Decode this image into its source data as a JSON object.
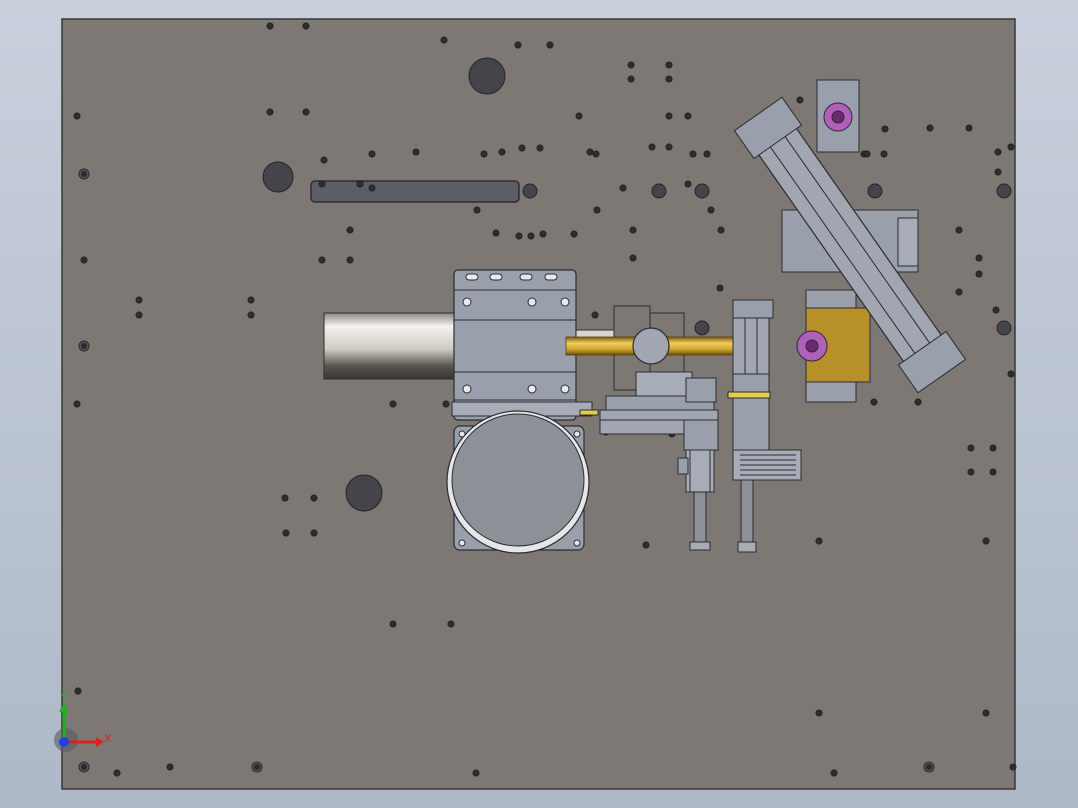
{
  "viewport": {
    "background_top": "#c9d0dc",
    "background_bottom": "#aeb8c8",
    "plate_color": "#7d7873",
    "plate_edge": "#3a3836",
    "hole_color": "#2e2d30",
    "part_fill": "#9aa0ab",
    "part_stroke": "#2a2c33",
    "gold_color": "#c9a22c",
    "brass_color": "#b8902a",
    "magenta_color": "#b060b8"
  },
  "triad": {
    "x_label": "X",
    "y_label": "Y",
    "x_color": "#e02020",
    "y_color": "#20b020",
    "z_color": "#2040e0"
  }
}
